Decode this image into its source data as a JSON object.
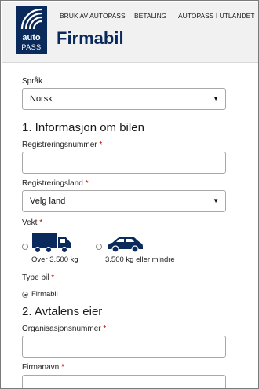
{
  "header": {
    "logo": {
      "word1": "auto",
      "word2": "PASS"
    },
    "nav": [
      {
        "label": "BRUK AV AUTOPASS"
      },
      {
        "label": "BETALING"
      },
      {
        "label": "AUTOPASS I UTLANDET"
      }
    ],
    "title": "Firmabil"
  },
  "form": {
    "language": {
      "label": "Språk",
      "value": "Norsk"
    },
    "section1": {
      "heading": "1. Informasjon om bilen"
    },
    "reg_number": {
      "label": "Registreringsnummer",
      "required": "*",
      "value": ""
    },
    "reg_country": {
      "label": "Registreringsland",
      "required": "*",
      "value": "Velg land"
    },
    "weight": {
      "label": "Vekt",
      "required": "*",
      "options": [
        {
          "label": "Over 3.500 kg",
          "icon": "truck-icon",
          "checked": false
        },
        {
          "label": "3.500 kg eller mindre",
          "icon": "car-icon",
          "checked": false
        }
      ]
    },
    "car_type": {
      "label": "Type bil",
      "required": "*",
      "options": [
        {
          "label": "Firmabil",
          "checked": true
        }
      ]
    },
    "section2": {
      "heading": "2. Avtalens eier"
    },
    "org_number": {
      "label": "Organisasjonsnummer",
      "required": "*",
      "value": ""
    },
    "company_name": {
      "label": "Firmanavn",
      "required": "*",
      "value": ""
    }
  },
  "colors": {
    "brand": "#0b2a5c",
    "required": "#c00000"
  }
}
